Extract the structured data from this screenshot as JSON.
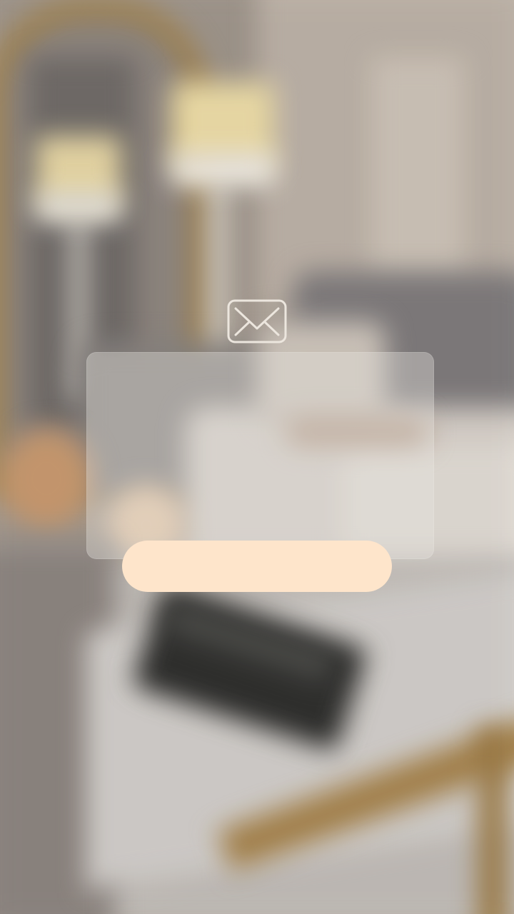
{
  "background": {
    "description_icon": "blurred-bedroom-photo"
  },
  "mail_icon": {
    "name": "envelope-icon",
    "color": "#ece6de"
  },
  "card": {
    "text": ""
  },
  "action_button": {
    "label": "",
    "color": "#fee5cb"
  }
}
